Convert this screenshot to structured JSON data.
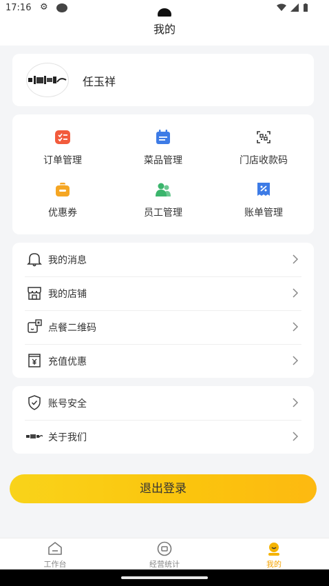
{
  "status_bar": {
    "time": "17:16"
  },
  "header": {
    "title": "我的"
  },
  "profile": {
    "username": "任玉祥"
  },
  "quick_actions": [
    {
      "label": "订单管理",
      "icon": "order-list-icon",
      "color": "#f25b3c"
    },
    {
      "label": "菜品管理",
      "icon": "dish-book-icon",
      "color": "#3d7be6"
    },
    {
      "label": "门店收款码",
      "icon": "scan-code-icon",
      "color": "#333333"
    },
    {
      "label": "优惠券",
      "icon": "coupon-icon",
      "color": "#f5a623"
    },
    {
      "label": "员工管理",
      "icon": "staff-icon",
      "color": "#3bb56c"
    },
    {
      "label": "账单管理",
      "icon": "bill-icon",
      "color": "#3d7be6"
    }
  ],
  "menu_group_1": [
    {
      "label": "我的消息",
      "icon": "bell-icon"
    },
    {
      "label": "我的店铺",
      "icon": "shop-icon"
    },
    {
      "label": "点餐二维码",
      "icon": "qr-code-icon"
    },
    {
      "label": "充值优惠",
      "icon": "recharge-icon"
    }
  ],
  "menu_group_2": [
    {
      "label": "账号安全",
      "icon": "shield-icon"
    },
    {
      "label": "关于我们",
      "icon": "about-logo-icon"
    }
  ],
  "logout_button": {
    "label": "退出登录",
    "color": "#fbc40d"
  },
  "tab_bar": {
    "tabs": [
      {
        "label": "工作台",
        "icon": "home-icon"
      },
      {
        "label": "经营统计",
        "icon": "stats-icon"
      },
      {
        "label": "我的",
        "icon": "profile-icon",
        "active": true
      }
    ],
    "active_color": "#f5a300"
  }
}
